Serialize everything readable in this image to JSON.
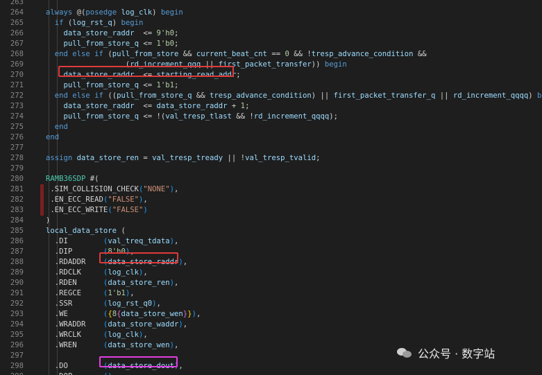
{
  "editor": {
    "lines": [
      {
        "n": "263",
        "segs": []
      },
      {
        "n": "264",
        "segs": [
          [
            "always",
            "kw"
          ],
          [
            " @(",
            "op"
          ],
          [
            "posedge",
            "kw"
          ],
          [
            " ",
            "op"
          ],
          [
            "log_clk",
            "id"
          ],
          [
            ") ",
            "op"
          ],
          [
            "begin",
            "kw"
          ]
        ]
      },
      {
        "n": "265",
        "segs": [
          [
            "  ",
            "op"
          ],
          [
            "if",
            "kw"
          ],
          [
            " (",
            "op"
          ],
          [
            "log_rst_q",
            "id"
          ],
          [
            ") ",
            "op"
          ],
          [
            "begin",
            "kw"
          ]
        ]
      },
      {
        "n": "266",
        "segs": [
          [
            "    ",
            "op"
          ],
          [
            "data_store_raddr",
            "id"
          ],
          [
            "  <= ",
            "op"
          ],
          [
            "9'h0",
            "num"
          ],
          [
            ";",
            "op"
          ]
        ]
      },
      {
        "n": "267",
        "segs": [
          [
            "    ",
            "op"
          ],
          [
            "pull_from_store_q",
            "id"
          ],
          [
            " <= ",
            "op"
          ],
          [
            "1'b0",
            "num"
          ],
          [
            ";",
            "op"
          ]
        ]
      },
      {
        "n": "268",
        "segs": [
          [
            "  ",
            "op"
          ],
          [
            "end else if",
            "kw"
          ],
          [
            " (",
            "op"
          ],
          [
            "pull_from_store",
            "id"
          ],
          [
            " && ",
            "op"
          ],
          [
            "current_beat_cnt",
            "id"
          ],
          [
            " == ",
            "op"
          ],
          [
            "0",
            "num"
          ],
          [
            " && !",
            "op"
          ],
          [
            "tresp_advance_condition",
            "id"
          ],
          [
            " &&",
            "op"
          ]
        ]
      },
      {
        "n": "269",
        "segs": [
          [
            "                  (",
            "op"
          ],
          [
            "rd_increment_qqq",
            "id"
          ],
          [
            " || ",
            "op"
          ],
          [
            "first_packet_transfer",
            "id"
          ],
          [
            ")) ",
            "op"
          ],
          [
            "begin",
            "kw"
          ]
        ]
      },
      {
        "n": "270",
        "segs": [
          [
            "    ",
            "op"
          ],
          [
            "data_store_raddr",
            "id"
          ],
          [
            "  <= ",
            "op"
          ],
          [
            "starting_read_addr",
            "id"
          ],
          [
            ";",
            "op"
          ]
        ]
      },
      {
        "n": "271",
        "segs": [
          [
            "    ",
            "op"
          ],
          [
            "pull_from_store_q",
            "id"
          ],
          [
            " <= ",
            "op"
          ],
          [
            "1'b1",
            "num"
          ],
          [
            ";",
            "op"
          ]
        ]
      },
      {
        "n": "272",
        "segs": [
          [
            "  ",
            "op"
          ],
          [
            "end else if",
            "kw"
          ],
          [
            " ((",
            "op"
          ],
          [
            "pull_from_store_q",
            "id"
          ],
          [
            " && ",
            "op"
          ],
          [
            "tresp_advance_condition",
            "id"
          ],
          [
            ") || ",
            "op"
          ],
          [
            "first_packet_transfer_q",
            "id"
          ],
          [
            " || ",
            "op"
          ],
          [
            "rd_increment_qqqq",
            "id"
          ],
          [
            ") ",
            "op"
          ],
          [
            "begin",
            "kw"
          ]
        ]
      },
      {
        "n": "273",
        "segs": [
          [
            "    ",
            "op"
          ],
          [
            "data_store_raddr",
            "id"
          ],
          [
            "  <= ",
            "op"
          ],
          [
            "data_store_raddr",
            "id"
          ],
          [
            " + ",
            "op"
          ],
          [
            "1",
            "num"
          ],
          [
            ";",
            "op"
          ]
        ]
      },
      {
        "n": "274",
        "segs": [
          [
            "    ",
            "op"
          ],
          [
            "pull_from_store_q",
            "id"
          ],
          [
            " <= !(",
            "op"
          ],
          [
            "val_tresp_tlast",
            "id"
          ],
          [
            " && !",
            "op"
          ],
          [
            "rd_increment_qqqq",
            "id"
          ],
          [
            ");",
            "op"
          ]
        ]
      },
      {
        "n": "275",
        "segs": [
          [
            "  ",
            "op"
          ],
          [
            "end",
            "kw"
          ]
        ]
      },
      {
        "n": "276",
        "segs": [
          [
            "end",
            "kw"
          ]
        ]
      },
      {
        "n": "277",
        "segs": []
      },
      {
        "n": "278",
        "segs": [
          [
            "assign",
            "kw"
          ],
          [
            " ",
            "op"
          ],
          [
            "data_store_ren",
            "id"
          ],
          [
            " = ",
            "op"
          ],
          [
            "val_tresp_tready",
            "id"
          ],
          [
            " || !",
            "op"
          ],
          [
            "val_tresp_tvalid",
            "id"
          ],
          [
            ";",
            "op"
          ]
        ]
      },
      {
        "n": "279",
        "segs": []
      },
      {
        "n": "280",
        "segs": [
          [
            "RAMB36SDP",
            "mod"
          ],
          [
            " #(",
            "op"
          ]
        ]
      },
      {
        "n": "281",
        "segs": [
          [
            " .",
            "op"
          ],
          [
            "SIM_COLLISION_CHECK",
            "port"
          ],
          [
            "(",
            "pc"
          ],
          [
            "\"NONE\"",
            "str"
          ],
          [
            ")",
            "pc"
          ],
          [
            ",",
            "op"
          ]
        ]
      },
      {
        "n": "282",
        "segs": [
          [
            " .",
            "op"
          ],
          [
            "EN_ECC_READ",
            "port"
          ],
          [
            "(",
            "pc"
          ],
          [
            "\"FALSE\"",
            "str"
          ],
          [
            ")",
            "pc"
          ],
          [
            ",",
            "op"
          ]
        ]
      },
      {
        "n": "283",
        "segs": [
          [
            " .",
            "op"
          ],
          [
            "EN_ECC_WRITE",
            "port"
          ],
          [
            "(",
            "pc"
          ],
          [
            "\"FALSE\"",
            "str"
          ],
          [
            ")",
            "pc"
          ]
        ]
      },
      {
        "n": "284",
        "segs": [
          [
            ")",
            "op"
          ]
        ]
      },
      {
        "n": "285",
        "segs": [
          [
            "local_data_store",
            "id"
          ],
          [
            " (",
            "op"
          ]
        ]
      },
      {
        "n": "286",
        "segs": [
          [
            "  .",
            "op"
          ],
          [
            "DI",
            "port"
          ],
          [
            "        (",
            "pc"
          ],
          [
            "val_treq_tdata",
            "id"
          ],
          [
            ")",
            "pc"
          ],
          [
            ",",
            "op"
          ]
        ]
      },
      {
        "n": "287",
        "segs": [
          [
            "  .",
            "op"
          ],
          [
            "DIP",
            "port"
          ],
          [
            "       (",
            "pc"
          ],
          [
            "8'h0",
            "num"
          ],
          [
            ")",
            "pc"
          ],
          [
            ",",
            "op"
          ]
        ]
      },
      {
        "n": "288",
        "segs": [
          [
            "  .",
            "op"
          ],
          [
            "RDADDR",
            "port"
          ],
          [
            "    (",
            "pc"
          ],
          [
            "data_store_raddr",
            "id"
          ],
          [
            ")",
            "pc"
          ],
          [
            ",",
            "op"
          ]
        ]
      },
      {
        "n": "289",
        "segs": [
          [
            "  .",
            "op"
          ],
          [
            "RDCLK",
            "port"
          ],
          [
            "     (",
            "pc"
          ],
          [
            "log_clk",
            "id"
          ],
          [
            ")",
            "pc"
          ],
          [
            ",",
            "op"
          ]
        ]
      },
      {
        "n": "290",
        "segs": [
          [
            "  .",
            "op"
          ],
          [
            "RDEN",
            "port"
          ],
          [
            "      (",
            "pc"
          ],
          [
            "data_store_ren",
            "id"
          ],
          [
            ")",
            "pc"
          ],
          [
            ",",
            "op"
          ]
        ]
      },
      {
        "n": "291",
        "segs": [
          [
            "  .",
            "op"
          ],
          [
            "REGCE",
            "port"
          ],
          [
            "     (",
            "pc"
          ],
          [
            "1'b1",
            "num"
          ],
          [
            ")",
            "pc"
          ],
          [
            ",",
            "op"
          ]
        ]
      },
      {
        "n": "292",
        "segs": [
          [
            "  .",
            "op"
          ],
          [
            "SSR",
            "port"
          ],
          [
            "       (",
            "pc"
          ],
          [
            "log_rst_q0",
            "id"
          ],
          [
            ")",
            "pc"
          ],
          [
            ",",
            "op"
          ]
        ]
      },
      {
        "n": "293",
        "segs": [
          [
            "  .",
            "op"
          ],
          [
            "WE",
            "port"
          ],
          [
            "        (",
            "pc"
          ],
          [
            "{",
            "pa"
          ],
          [
            "8",
            "num"
          ],
          [
            "{",
            "pb"
          ],
          [
            "data_store_wen",
            "id"
          ],
          [
            "}",
            "pb"
          ],
          [
            "}",
            "pa"
          ],
          [
            ")",
            "pc"
          ],
          [
            ",",
            "op"
          ]
        ]
      },
      {
        "n": "294",
        "segs": [
          [
            "  .",
            "op"
          ],
          [
            "WRADDR",
            "port"
          ],
          [
            "    (",
            "pc"
          ],
          [
            "data_store_waddr",
            "id"
          ],
          [
            ")",
            "pc"
          ],
          [
            ",",
            "op"
          ]
        ]
      },
      {
        "n": "295",
        "segs": [
          [
            "  .",
            "op"
          ],
          [
            "WRCLK",
            "port"
          ],
          [
            "     (",
            "pc"
          ],
          [
            "log_clk",
            "id"
          ],
          [
            ")",
            "pc"
          ],
          [
            ",",
            "op"
          ]
        ]
      },
      {
        "n": "296",
        "segs": [
          [
            "  .",
            "op"
          ],
          [
            "WREN",
            "port"
          ],
          [
            "      (",
            "pc"
          ],
          [
            "data_store_wen",
            "id"
          ],
          [
            ")",
            "pc"
          ],
          [
            ",",
            "op"
          ]
        ]
      },
      {
        "n": "297",
        "segs": []
      },
      {
        "n": "298",
        "segs": [
          [
            "  .",
            "op"
          ],
          [
            "DO",
            "port"
          ],
          [
            "        (",
            "pc"
          ],
          [
            "data_store_dout",
            "id"
          ],
          [
            ")",
            "pc"
          ],
          [
            ",",
            "op"
          ]
        ]
      },
      {
        "n": "299",
        "segs": [
          [
            "  .",
            "op"
          ],
          [
            "DOP",
            "port"
          ],
          [
            "       (",
            "pc"
          ],
          [
            ")",
            "pc"
          ],
          [
            ",",
            "op"
          ]
        ]
      }
    ]
  },
  "watermark": {
    "text": "公众号 · 数字站"
  },
  "colors": {
    "highlight_red": "#e03a3a",
    "highlight_magenta": "#e040e0",
    "background": "#1e1e1e"
  }
}
